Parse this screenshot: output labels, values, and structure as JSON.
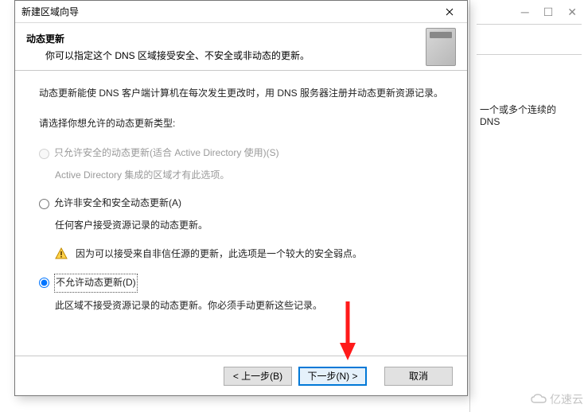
{
  "bg": {
    "partial_text": "一个或多个连续的 DNS"
  },
  "wizard": {
    "title": "新建区域向导",
    "header": {
      "title": "动态更新",
      "desc": "你可以指定这个 DNS 区域接受安全、不安全或非动态的更新。"
    },
    "content": {
      "intro": "动态更新能使 DNS 客户端计算机在每次发生更改时，用 DNS 服务器注册并动态更新资源记录。",
      "prompt": "请选择你想允许的动态更新类型:",
      "opt1": {
        "label": "只允许安全的动态更新(适合 Active Directory 使用)(S)",
        "sub": "Active Directory 集成的区域才有此选项。"
      },
      "opt2": {
        "label": "允许非安全和安全动态更新(A)",
        "sub": "任何客户接受资源记录的动态更新。",
        "warn": "因为可以接受来自非信任源的更新，此选项是一个较大的安全弱点。"
      },
      "opt3": {
        "label": "不允许动态更新(D)",
        "sub": "此区域不接受资源记录的动态更新。你必须手动更新这些记录。"
      }
    },
    "buttons": {
      "back": "< 上一步(B)",
      "next": "下一步(N) >",
      "cancel": "取消"
    }
  },
  "logo": "亿速云"
}
